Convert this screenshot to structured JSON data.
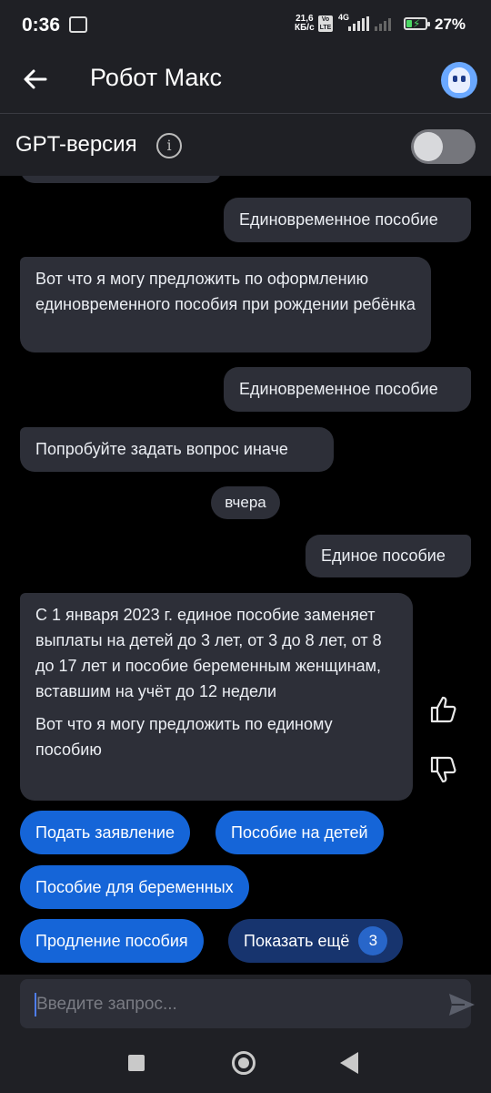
{
  "status_bar": {
    "time": "0:36",
    "speed_value": "21,6",
    "speed_unit": "КБ/с",
    "volte_top": "Vo",
    "volte_bottom": "LTE",
    "network": "4G",
    "battery_percent": "27%",
    "battery_level": 0.27
  },
  "app_bar": {
    "title": "Робот Макс",
    "back_icon": "arrow-left",
    "avatar_icon": "robot-avatar"
  },
  "gpt_bar": {
    "label": "GPT-версия",
    "info_icon": "info-circle",
    "toggle_on": false
  },
  "chat": {
    "messages": [
      {
        "from": "user",
        "text": "Единовременное пособие"
      },
      {
        "from": "bot",
        "text": "Вот что я могу предложить по оформлению единовременного пособия при рождении ребёнка"
      },
      {
        "from": "user",
        "text": "Единовременное пособие"
      },
      {
        "from": "bot",
        "text": "Попробуйте задать вопрос иначе"
      },
      {
        "from": "user",
        "text": "Единое пособие"
      },
      {
        "from": "bot",
        "paragraphs": [
          "С 1 января 2023 г. единое пособие заменяет выплаты на детей до 3 лет, от 3 до 8 лет, от 8 до 17 лет и пособие беременным женщинам, вставшим на учёт до 12 недели",
          "Вот что я могу предложить по единому пособию"
        ]
      }
    ],
    "date_separator": "вчера",
    "reactions": {
      "like_icon": "thumbs-up",
      "dislike_icon": "thumbs-down"
    },
    "quick_replies": [
      "Подать заявление",
      "Пособие на детей",
      "Пособие для беременных",
      "Продление пособия"
    ],
    "show_more": {
      "label": "Показать ещё",
      "count": "3"
    }
  },
  "input": {
    "placeholder": "Введите запрос...",
    "value": "",
    "send_icon": "send-arrow"
  },
  "nav_bar": {
    "icons": [
      "recents-square",
      "home-circle",
      "back-triangle"
    ]
  },
  "colors": {
    "background": "#000000",
    "bar": "#1f2025",
    "bubble": "#2d2f38",
    "chip_blue": "#1565d8",
    "chip_dark": "#17346e"
  }
}
